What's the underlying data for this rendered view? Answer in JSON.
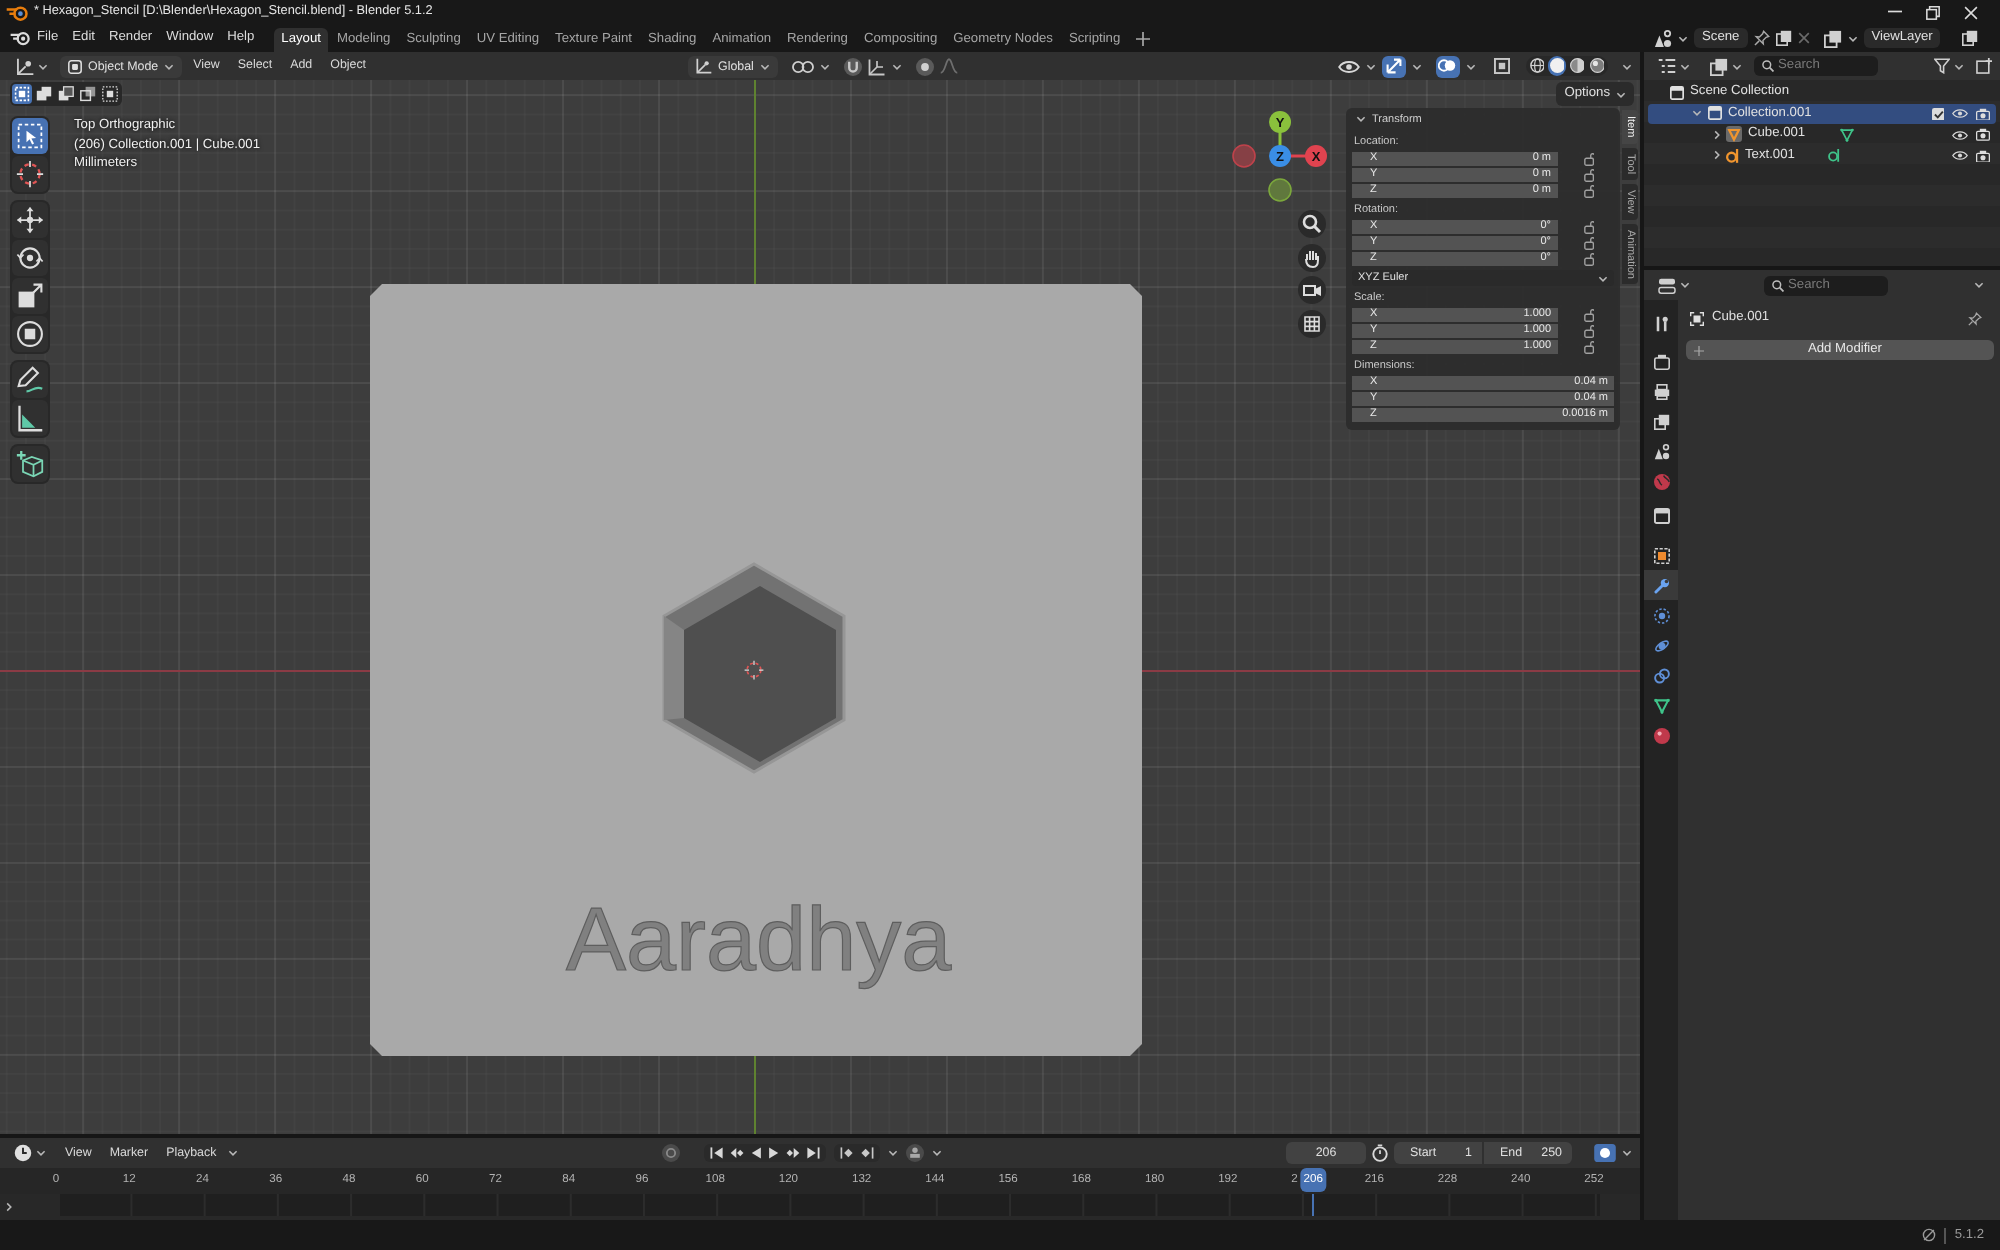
{
  "window": {
    "title": "* Hexagon_Stencil [D:\\Blender\\Hexagon_Stencil.blend] - Blender 5.1.2"
  },
  "menu_bar": {
    "menus": [
      "File",
      "Edit",
      "Render",
      "Window",
      "Help"
    ],
    "workspaces": [
      {
        "label": "Layout",
        "selected": true
      },
      {
        "label": "Modeling",
        "selected": false
      },
      {
        "label": "Sculpting",
        "selected": false
      },
      {
        "label": "UV Editing",
        "selected": false
      },
      {
        "label": "Texture Paint",
        "selected": false
      },
      {
        "label": "Shading",
        "selected": false
      },
      {
        "label": "Animation",
        "selected": false
      },
      {
        "label": "Rendering",
        "selected": false
      },
      {
        "label": "Compositing",
        "selected": false
      },
      {
        "label": "Geometry Nodes",
        "selected": false
      },
      {
        "label": "Scripting",
        "selected": false
      }
    ],
    "scene": "Scene",
    "view_layer": "ViewLayer"
  },
  "viewport_header": {
    "mode": "Object Mode",
    "menus": [
      "View",
      "Select",
      "Add",
      "Object"
    ],
    "orientation": "Global",
    "gizmos": {
      "on": true
    },
    "overlays": {
      "on": true
    },
    "xray": {
      "on": false
    },
    "shading_modes": [
      {
        "kind": "wireframe",
        "selected": false
      },
      {
        "kind": "solid",
        "selected": true
      },
      {
        "kind": "material",
        "selected": false
      },
      {
        "kind": "rendered",
        "selected": false
      }
    ]
  },
  "viewport": {
    "select_modes": [
      {
        "kind": "set",
        "selected": true
      },
      {
        "kind": "extend",
        "selected": false
      },
      {
        "kind": "subtract",
        "selected": false
      },
      {
        "kind": "invert",
        "selected": false
      },
      {
        "kind": "intersect",
        "selected": false
      }
    ],
    "tool_groups": [
      {
        "tools": [
          {
            "kind": "select_box",
            "selected": true
          },
          {
            "kind": "cursor",
            "selected": false
          }
        ]
      },
      {
        "tools": [
          {
            "kind": "move",
            "selected": false
          },
          {
            "kind": "rotate",
            "selected": false
          },
          {
            "kind": "scale",
            "selected": false
          },
          {
            "kind": "transform",
            "selected": false
          }
        ]
      },
      {
        "tools": [
          {
            "kind": "annotate",
            "selected": false
          },
          {
            "kind": "measure",
            "selected": false
          }
        ]
      },
      {
        "tools": [
          {
            "kind": "add_cube",
            "selected": false
          }
        ]
      }
    ],
    "info": [
      "Top Orthographic",
      "(206) Collection.001 | Cube.001",
      "Millimeters"
    ],
    "gizmo": [
      {
        "label": "Y",
        "color": "#8ac13c"
      },
      {
        "label": "Z",
        "color": "#3a8ee6"
      },
      {
        "label": "X",
        "color": "#e0434f"
      }
    ],
    "model_text": "Aaradhya",
    "options": "Options"
  },
  "sidebar": {
    "tabs": [
      {
        "label": "Item",
        "selected": true
      },
      {
        "label": "Tool",
        "selected": false
      },
      {
        "label": "View",
        "selected": false
      },
      {
        "label": "Animation",
        "selected": false
      }
    ],
    "panel": {
      "title": "Transform",
      "expanded": true,
      "groups": [
        {
          "label": "Location:",
          "fields": [
            {
              "axis": "X",
              "value": "0 m",
              "locked": false
            },
            {
              "axis": "Y",
              "value": "0 m",
              "locked": false
            },
            {
              "axis": "Z",
              "value": "0 m",
              "locked": false
            }
          ]
        },
        {
          "label": "Rotation:",
          "fields": [
            {
              "axis": "X",
              "value": "0°",
              "locked": false
            },
            {
              "axis": "Y",
              "value": "0°",
              "locked": false
            },
            {
              "axis": "Z",
              "value": "0°",
              "locked": false
            }
          ],
          "mode": "XYZ Euler"
        },
        {
          "label": "Scale:",
          "fields": [
            {
              "axis": "X",
              "value": "1.000",
              "locked": false
            },
            {
              "axis": "Y",
              "value": "1.000",
              "locked": false
            },
            {
              "axis": "Z",
              "value": "1.000",
              "locked": false
            }
          ]
        },
        {
          "label": "Dimensions:",
          "fields": [
            {
              "axis": "X",
              "value": "0.04 m"
            },
            {
              "axis": "Y",
              "value": "0.04 m"
            },
            {
              "axis": "Z",
              "value": "0.0016 m"
            }
          ]
        }
      ]
    }
  },
  "outliner": {
    "search_placeholder": "Search",
    "root": "Scene Collection",
    "items": [
      {
        "label": "Collection.001",
        "kind": "collection",
        "selected": true,
        "expanded": true,
        "checked": true,
        "children": [
          {
            "label": "Cube.001",
            "kind": "mesh",
            "selected": false,
            "expanded": false
          },
          {
            "label": "Text.001",
            "kind": "text",
            "selected": false,
            "expanded": false
          }
        ]
      }
    ]
  },
  "properties": {
    "search_placeholder": "Search",
    "tabs": [
      {
        "kind": "tool",
        "selected": false
      },
      {
        "kind": "render",
        "selected": false
      },
      {
        "kind": "output",
        "selected": false
      },
      {
        "kind": "view_layer",
        "selected": false
      },
      {
        "kind": "scene",
        "selected": false
      },
      {
        "kind": "world",
        "selected": false
      },
      {
        "kind": "collection",
        "selected": false
      },
      {
        "kind": "object",
        "selected": false
      },
      {
        "kind": "modifiers",
        "selected": true
      },
      {
        "kind": "particles",
        "selected": false
      },
      {
        "kind": "physics",
        "selected": false
      },
      {
        "kind": "constraints",
        "selected": false
      },
      {
        "kind": "data",
        "selected": false
      },
      {
        "kind": "material",
        "selected": false
      }
    ],
    "object": "Cube.001",
    "add_modifier": "Add Modifier"
  },
  "timeline": {
    "menus": [
      "View",
      "Marker",
      "Playback"
    ],
    "current_frame": "206",
    "start_label": "Start",
    "start": "1",
    "end_label": "End",
    "end": "250",
    "ruler": [
      "0",
      "12",
      "24",
      "36",
      "48",
      "60",
      "72",
      "84",
      "96",
      "108",
      "120",
      "132",
      "144",
      "156",
      "168",
      "180",
      "192",
      "2",
      "216",
      "228",
      "240",
      "252"
    ],
    "playhead": "206"
  },
  "status_bar": {
    "version": "5.1.2"
  }
}
